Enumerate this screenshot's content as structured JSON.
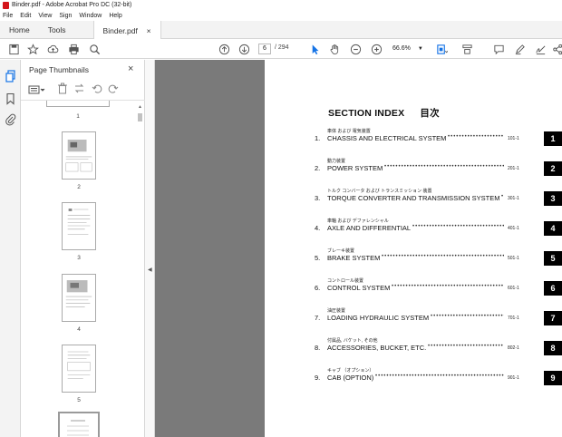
{
  "window": {
    "title": "Binder.pdf - Adobe Acrobat Pro DC (32-bit)"
  },
  "menu": [
    "File",
    "Edit",
    "View",
    "Sign",
    "Window",
    "Help"
  ],
  "tabs": {
    "home": "Home",
    "tools": "Tools",
    "file": "Binder.pdf",
    "close": "×"
  },
  "toolbar": {
    "page_current": "6",
    "page_total": "/ 294",
    "zoom": "66.6%",
    "icons": [
      "save-icon",
      "star-icon",
      "upload-icon",
      "print-icon",
      "search-icon",
      "page-up-icon",
      "page-down-icon",
      "select-cursor-icon",
      "hand-icon",
      "zoom-out-icon",
      "zoom-in-icon",
      "fit-page-icon",
      "scroll-mode-icon",
      "comment-icon",
      "highlight-icon",
      "sign-icon",
      "share-icon"
    ]
  },
  "panel": {
    "title": "Page Thumbnails",
    "close": "×",
    "thumbnails": [
      {
        "label": "1"
      },
      {
        "label": "2"
      },
      {
        "label": "3"
      },
      {
        "label": "4"
      },
      {
        "label": "5"
      }
    ]
  },
  "document": {
    "title": "SECTION INDEX",
    "title_jp": "目次",
    "entries": [
      {
        "num": "1.",
        "jp": "車体 および 電気装置",
        "name": "CHASSIS AND ELECTRICAL SYSTEM",
        "page": "101-1",
        "tab": "1"
      },
      {
        "num": "2.",
        "jp": "動力装置",
        "name": "POWER SYSTEM",
        "page": "201-1",
        "tab": "2"
      },
      {
        "num": "3.",
        "jp": "トルク コンバータ および トランスミッション 装置",
        "name": "TORQUE CONVERTER AND TRANSMISSION SYSTEM",
        "page": "301-1",
        "tab": "3"
      },
      {
        "num": "4.",
        "jp": "車軸 および デファレンシャル",
        "name": "AXLE AND DIFFERENTIAL",
        "page": "401-1",
        "tab": "4"
      },
      {
        "num": "5.",
        "jp": "ブレーキ装置",
        "name": "BRAKE SYSTEM",
        "page": "501-1",
        "tab": "5"
      },
      {
        "num": "6.",
        "jp": "コントロール装置",
        "name": "CONTROL SYSTEM",
        "page": "601-1",
        "tab": "6"
      },
      {
        "num": "7.",
        "jp": "油圧装置",
        "name": "LOADING HYDRAULIC SYSTEM",
        "page": "701-1",
        "tab": "7"
      },
      {
        "num": "8.",
        "jp": "付属品, バケット, その他",
        "name": "ACCESSORIES, BUCKET, ETC.",
        "page": "802-1",
        "tab": "8"
      },
      {
        "num": "9.",
        "jp": "キャブ （オプション）",
        "name": "CAB (OPTION)",
        "page": "901-1",
        "tab": "9"
      }
    ]
  }
}
